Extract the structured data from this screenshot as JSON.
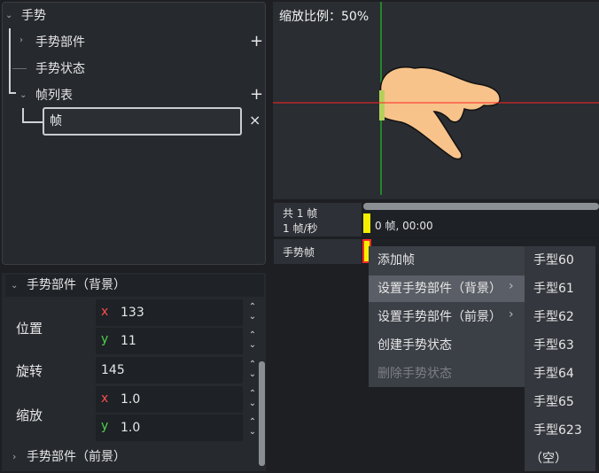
{
  "tree": {
    "root_label": "手势",
    "parts_label": "手势部件",
    "state_label": "手势状态",
    "frames_label": "帧列表",
    "frame_edit_value": "帧",
    "plus_glyph": "+",
    "close_glyph": "×"
  },
  "inspector": {
    "header": "手势部件（背景）",
    "position_label": "位置",
    "pos_x": "133",
    "pos_y": "11",
    "rotation_label": "旋转",
    "rotation": "145",
    "scale_label": "缩放",
    "scale_x": "1.0",
    "scale_y": "1.0",
    "axis_x": "x",
    "axis_y": "y",
    "foreground_label": "手势部件（前景）"
  },
  "viewport": {
    "zoom_label": "缩放比例：50%"
  },
  "timeline": {
    "total_frames": "共 1 帧",
    "fps": "1 帧/秒",
    "frame_info": "0 帧, 00:00",
    "track_label": "手势帧"
  },
  "context_menu": {
    "items": [
      "添加帧",
      "设置手势部件（背景）",
      "设置手势部件（前景）",
      "创建手势状态",
      "删除手势状态"
    ],
    "submenu": [
      "手型60",
      "手型61",
      "手型62",
      "手型63",
      "手型64",
      "手型65",
      "手型623",
      "（空）"
    ]
  },
  "colors": {
    "axis_x": "#ff4d4d",
    "axis_y": "#4dd14d",
    "keyframe": "#f5f000",
    "skin": "#f7c38b"
  }
}
